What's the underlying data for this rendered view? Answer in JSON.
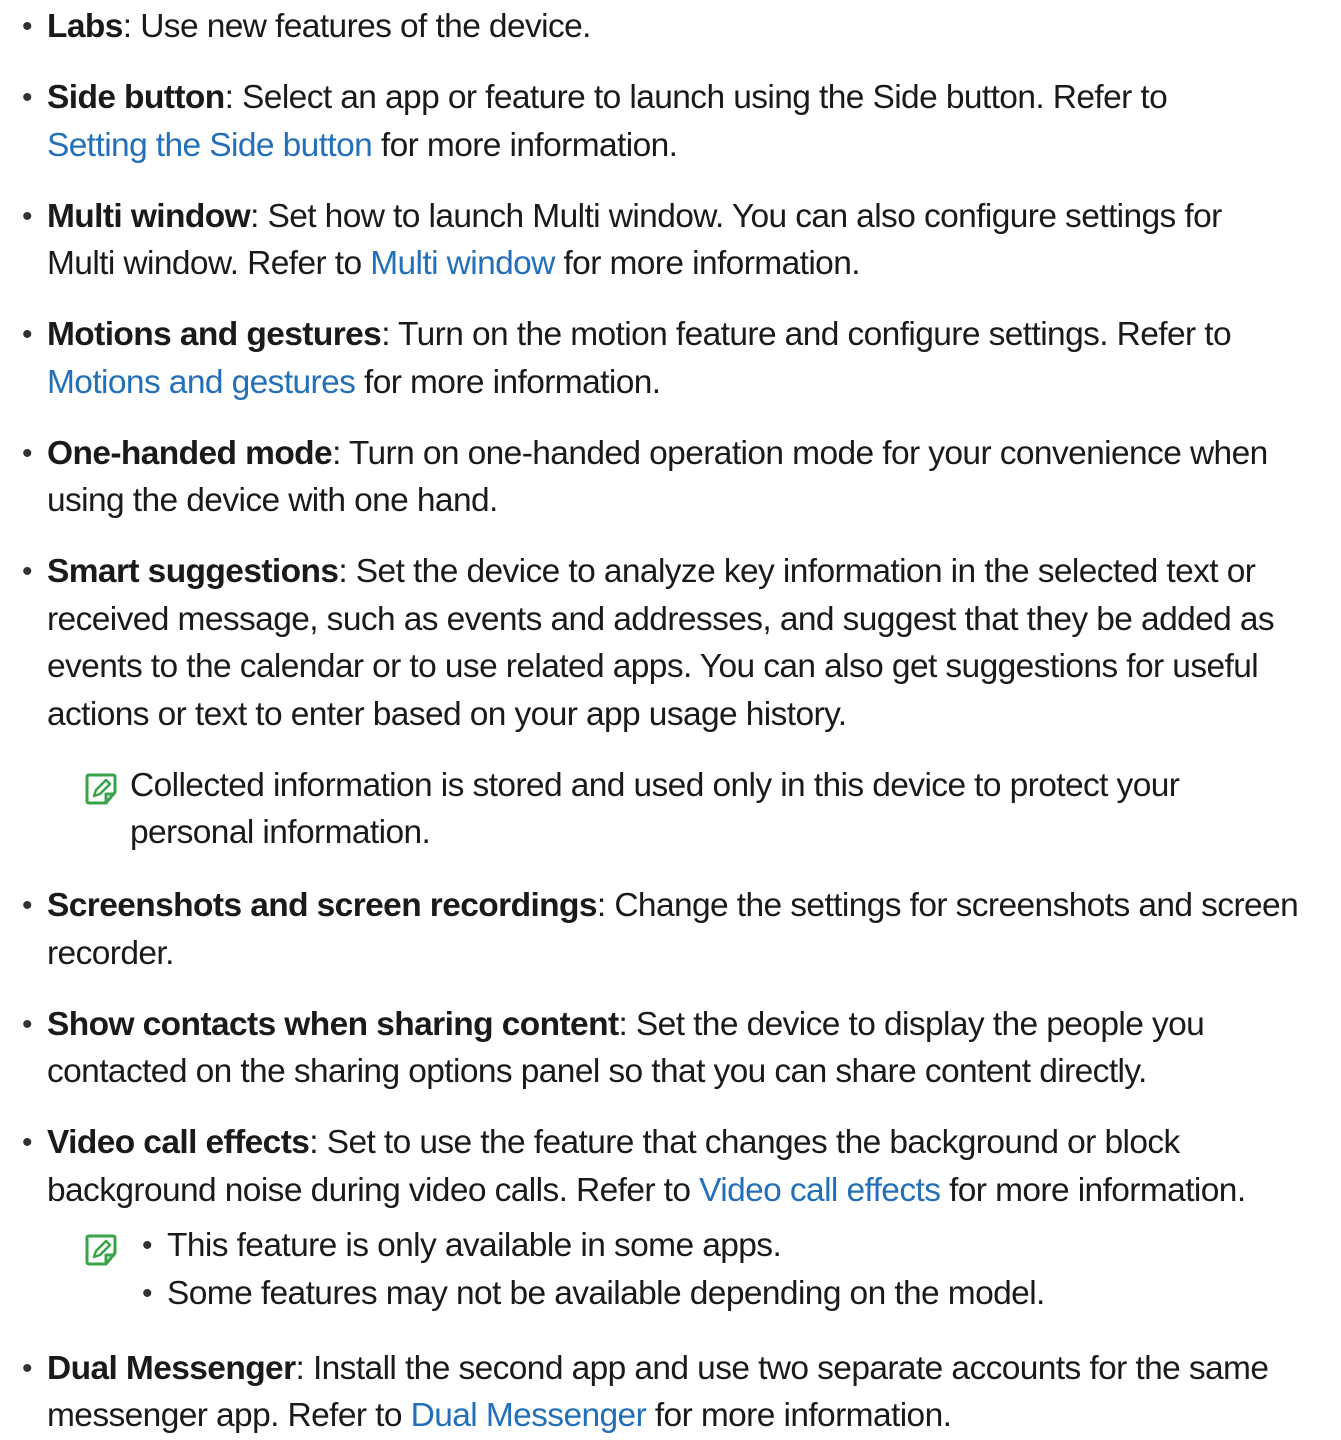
{
  "items": [
    {
      "term": "Labs",
      "lines": [
        [
          {
            "t": ": Use new features of the device."
          }
        ]
      ]
    },
    {
      "term": "Side button",
      "lines": [
        [
          {
            "t": ": Select an app or feature to launch using the Side button. Refer to"
          }
        ],
        [
          {
            "t": "Setting the Side button",
            "link": true
          },
          {
            "t": " for more information."
          }
        ]
      ]
    },
    {
      "term": "Multi window",
      "lines": [
        [
          {
            "t": ": Set how to launch Multi window. You can also configure settings for"
          }
        ],
        [
          {
            "t": "Multi window. Refer to "
          },
          {
            "t": "Multi window",
            "link": true
          },
          {
            "t": " for more information."
          }
        ]
      ]
    },
    {
      "term": "Motions and gestures",
      "lines": [
        [
          {
            "t": ": Turn on the motion feature and configure settings. Refer to"
          }
        ],
        [
          {
            "t": "Motions and gestures",
            "link": true
          },
          {
            "t": " for more information."
          }
        ]
      ]
    },
    {
      "term": "One-handed mode",
      "lines": [
        [
          {
            "t": ": Turn on one-handed operation mode for your convenience when"
          }
        ],
        [
          {
            "t": "using the device with one hand."
          }
        ]
      ]
    },
    {
      "term": "Smart suggestions",
      "lines": [
        [
          {
            "t": ": Set the device to analyze key information in the selected text or"
          }
        ],
        [
          {
            "t": "received message, such as events and addresses, and suggest that they be added as"
          }
        ],
        [
          {
            "t": "events to the calendar or to use related apps. You can also get suggestions for useful"
          }
        ],
        [
          {
            "t": "actions or text to enter based on your app usage history."
          }
        ]
      ]
    },
    {
      "term": "Screenshots and screen recordings",
      "lines": [
        [
          {
            "t": ": Change the settings for screenshots and screen"
          }
        ],
        [
          {
            "t": "recorder."
          }
        ]
      ]
    },
    {
      "term": "Show contacts when sharing content",
      "lines": [
        [
          {
            "t": ": Set the device to display the people you"
          }
        ],
        [
          {
            "t": "contacted on the sharing options panel so that you can share content directly."
          }
        ]
      ]
    },
    {
      "term": "Video call effects",
      "lines": [
        [
          {
            "t": ": Set to use the feature that changes the background or block"
          }
        ],
        [
          {
            "t": "background noise during video calls. Refer to "
          },
          {
            "t": "Video call effects",
            "link": true
          },
          {
            "t": " for more information."
          }
        ]
      ]
    },
    {
      "term": "Dual Messenger",
      "lines": [
        [
          {
            "t": ": Install the second app and use two separate accounts for the same"
          }
        ],
        [
          {
            "t": "messenger app. Refer to "
          },
          {
            "t": "Dual Messenger",
            "link": true
          },
          {
            "t": " for more information."
          }
        ]
      ]
    }
  ],
  "notes": {
    "smart_suggestions": {
      "icon": "note-icon",
      "lines": [
        "Collected information is stored and used only in this device to protect your",
        "personal information."
      ]
    },
    "video_call_effects": {
      "icon": "note-icon",
      "bullets": [
        "This feature is only available in some apps.",
        "Some features may not be available depending on the model."
      ]
    }
  },
  "bullet_char": "•",
  "colors": {
    "text": "#1a1a1a",
    "link": "#2470b8",
    "note_icon": "#3aa34a"
  }
}
